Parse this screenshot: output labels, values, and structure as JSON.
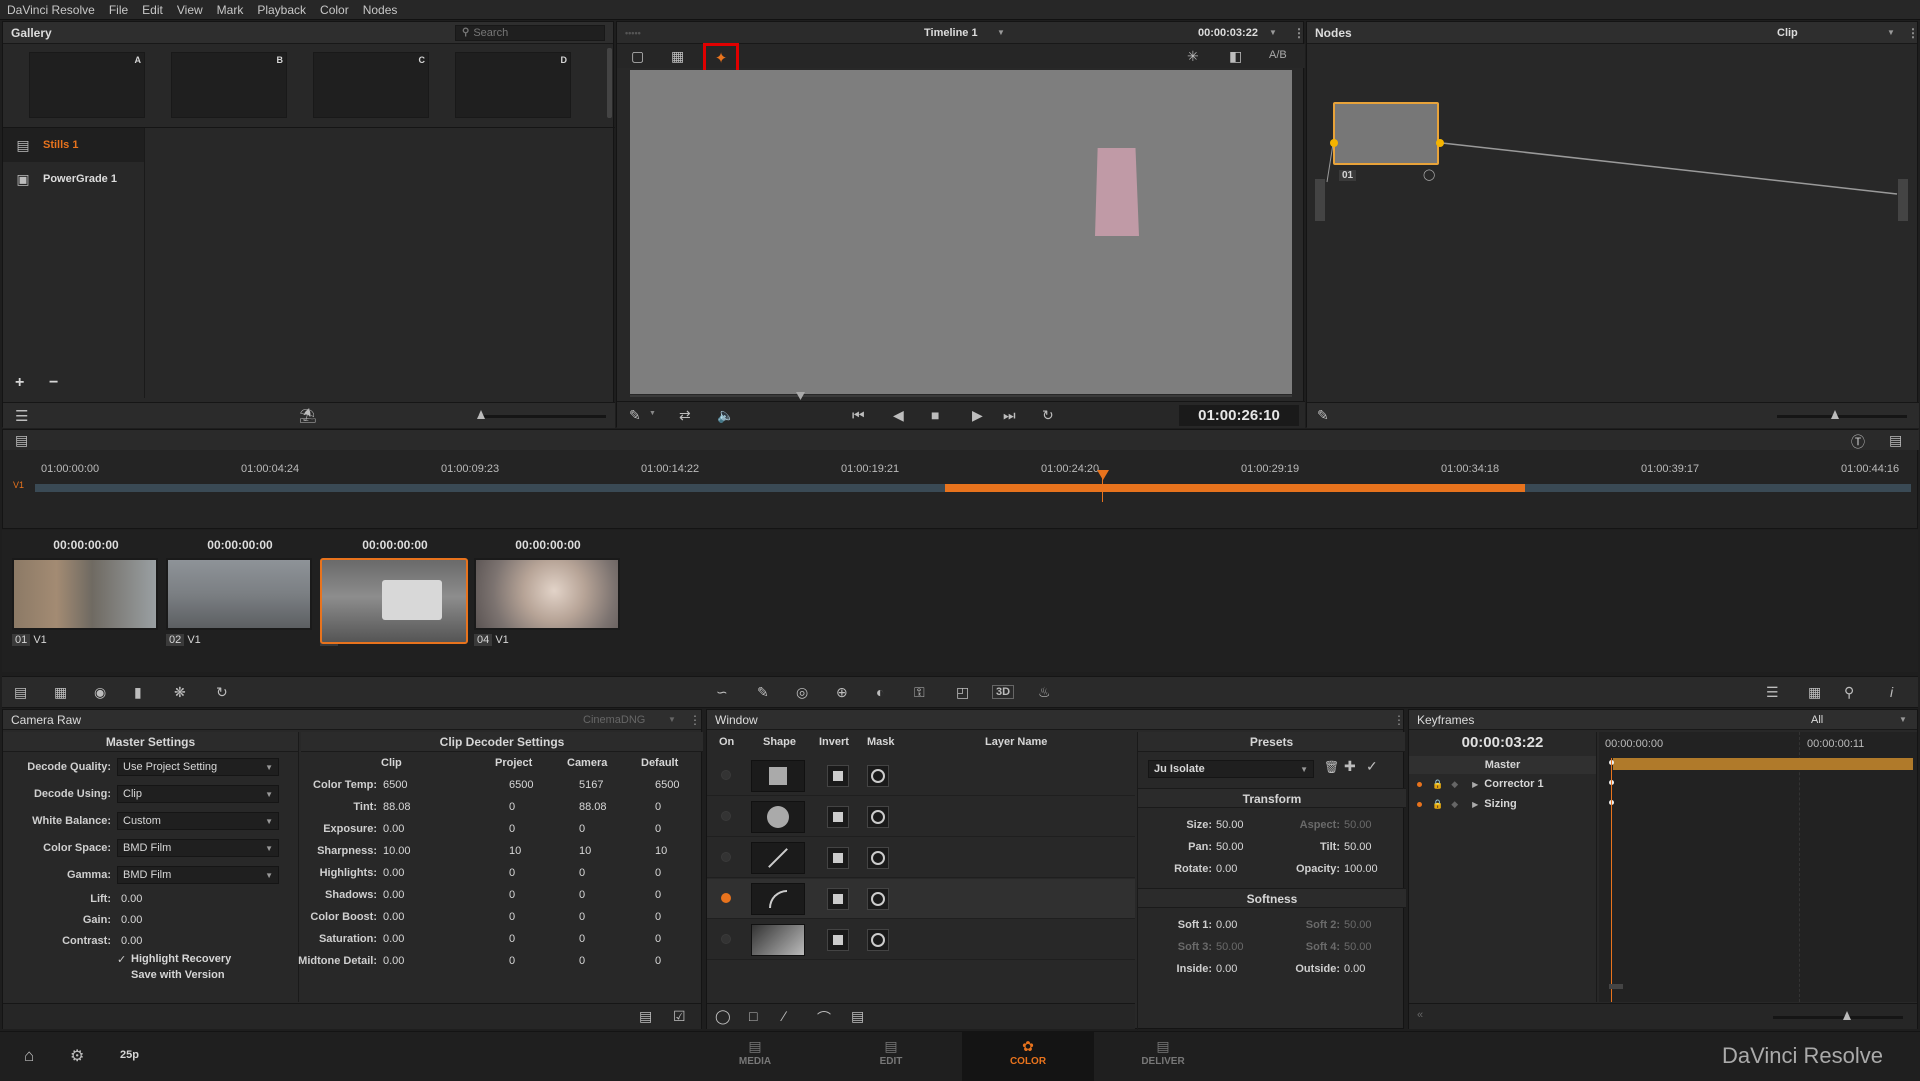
{
  "menu": {
    "app": "DaVinci Resolve",
    "items": [
      "File",
      "Edit",
      "View",
      "Mark",
      "Playback",
      "Color",
      "Nodes"
    ]
  },
  "gallery": {
    "title": "Gallery",
    "search_placeholder": "Search",
    "slots": [
      "A",
      "B",
      "C",
      "D"
    ],
    "albums": [
      {
        "label": "Stills 1",
        "active": true
      },
      {
        "label": "PowerGrade 1",
        "active": false
      }
    ],
    "add": "+",
    "remove": "−"
  },
  "viewer": {
    "timeline": "Timeline 1",
    "timecode_top": "00:00:03:22",
    "ab": "A/B",
    "timecode": "01:00:26:10"
  },
  "nodes": {
    "title": "Nodes",
    "mode": "Clip",
    "node_label": "01"
  },
  "timeline": {
    "track": "V1",
    "ticks": [
      "01:00:00:00",
      "01:00:04:24",
      "01:00:09:23",
      "01:00:14:22",
      "01:00:19:21",
      "01:00:24:20",
      "01:00:29:19",
      "01:00:34:18",
      "01:00:39:17",
      "01:00:44:16"
    ]
  },
  "clips": [
    {
      "tc": "00:00:00:00",
      "num": "01",
      "track": "V1"
    },
    {
      "tc": "00:00:00:00",
      "num": "02",
      "track": "V1"
    },
    {
      "tc": "00:00:00:00",
      "num": "03",
      "track": "V1"
    },
    {
      "tc": "00:00:00:00",
      "num": "04",
      "track": "V1"
    }
  ],
  "camera_raw": {
    "title": "Camera Raw",
    "format": "CinemaDNG",
    "master_title": "Master Settings",
    "master": [
      {
        "label": "Decode Quality:",
        "value": "Use Project Setting"
      },
      {
        "label": "Decode Using:",
        "value": "Clip"
      },
      {
        "label": "White Balance:",
        "value": "Custom"
      },
      {
        "label": "Color Space:",
        "value": "BMD Film"
      },
      {
        "label": "Gamma:",
        "value": "BMD Film"
      }
    ],
    "master_fields": [
      {
        "label": "Lift:",
        "value": "0.00"
      },
      {
        "label": "Gain:",
        "value": "0.00"
      },
      {
        "label": "Contrast:",
        "value": "0.00"
      }
    ],
    "highlight_recovery": "Highlight Recovery",
    "save_with_version": "Save with Version",
    "decoder_title": "Clip Decoder Settings",
    "cols": [
      "Clip",
      "Project",
      "Camera",
      "Default"
    ],
    "rows": [
      {
        "label": "Color Temp:",
        "clip": "6500",
        "project": "6500",
        "camera": "5167",
        "default": "6500"
      },
      {
        "label": "Tint:",
        "clip": "88.08",
        "project": "0",
        "camera": "88.08",
        "default": "0"
      },
      {
        "label": "Exposure:",
        "clip": "0.00",
        "project": "0",
        "camera": "0",
        "default": "0"
      },
      {
        "label": "Sharpness:",
        "clip": "10.00",
        "project": "10",
        "camera": "10",
        "default": "10"
      },
      {
        "label": "Highlights:",
        "clip": "0.00",
        "project": "0",
        "camera": "0",
        "default": "0"
      },
      {
        "label": "Shadows:",
        "clip": "0.00",
        "project": "0",
        "camera": "0",
        "default": "0"
      },
      {
        "label": "Color Boost:",
        "clip": "0.00",
        "project": "0",
        "camera": "0",
        "default": "0"
      },
      {
        "label": "Saturation:",
        "clip": "0.00",
        "project": "0",
        "camera": "0",
        "default": "0"
      },
      {
        "label": "Midtone Detail:",
        "clip": "0.00",
        "project": "0",
        "camera": "0",
        "default": "0"
      }
    ]
  },
  "window": {
    "title": "Window",
    "cols": [
      "On",
      "Shape",
      "Invert",
      "Mask",
      "Layer Name"
    ]
  },
  "presets": {
    "title": "Presets",
    "value": "Ju Isolate",
    "transform_title": "Transform",
    "size": "Size:",
    "size_v": "50.00",
    "aspect": "Aspect:",
    "aspect_v": "50.00",
    "pan": "Pan:",
    "pan_v": "50.00",
    "tilt": "Tilt:",
    "tilt_v": "50.00",
    "rotate": "Rotate:",
    "rotate_v": "0.00",
    "opacity": "Opacity:",
    "opacity_v": "100.00",
    "softness_title": "Softness",
    "soft1": "Soft 1:",
    "soft1_v": "0.00",
    "soft2": "Soft 2:",
    "soft2_v": "50.00",
    "soft3": "Soft 3:",
    "soft3_v": "50.00",
    "soft4": "Soft 4:",
    "soft4_v": "50.00",
    "inside": "Inside:",
    "inside_v": "0.00",
    "outside": "Outside:",
    "outside_v": "0.00"
  },
  "keyframes": {
    "title": "Keyframes",
    "filter": "All",
    "tc": "00:00:03:22",
    "t0": "00:00:00:00",
    "t1": "00:00:00:11",
    "master": "Master",
    "tracks": [
      "Corrector 1",
      "Sizing"
    ]
  },
  "bottom": {
    "fps": "25p",
    "pages": [
      {
        "label": "MEDIA",
        "active": false
      },
      {
        "label": "EDIT",
        "active": false
      },
      {
        "label": "COLOR",
        "active": true
      },
      {
        "label": "DELIVER",
        "active": false
      }
    ],
    "brand": "DaVinci Resolve"
  },
  "colors": {
    "accent": "#e8731d",
    "highlight_box": "#e00000"
  }
}
